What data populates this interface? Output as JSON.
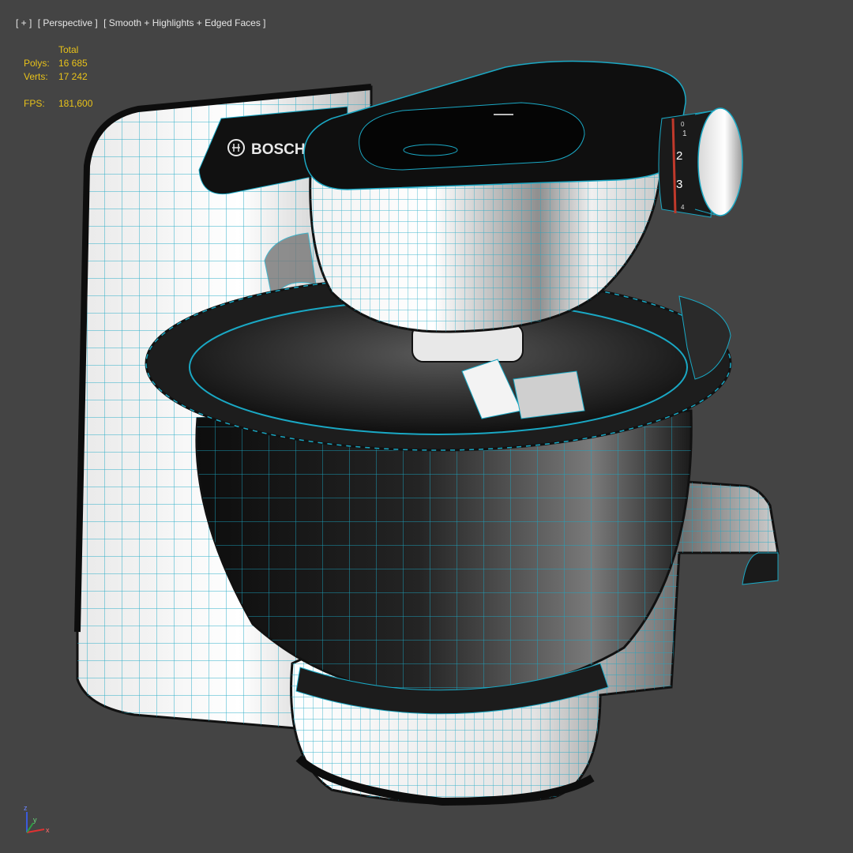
{
  "viewport": {
    "plus": "[ + ]",
    "view": "[ Perspective ]",
    "shading": "[ Smooth + Highlights + Edged Faces ]",
    "background": "#444444",
    "wire_color": "#1aa8c4"
  },
  "stats": {
    "header": "Total",
    "polys_label": "Polys:",
    "polys_value": "16 685",
    "verts_label": "Verts:",
    "verts_value": "17 242",
    "fps_label": "FPS:",
    "fps_value": "181,600",
    "color": "#e8c21a"
  },
  "model": {
    "brand": "BOSCH",
    "dial_marks": [
      "0",
      "1",
      "2",
      "3",
      "4"
    ]
  },
  "axis": {
    "x": "x",
    "y": "y",
    "z": "z"
  }
}
